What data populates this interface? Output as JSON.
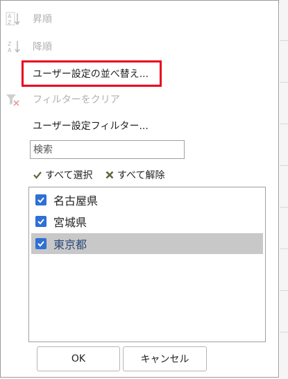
{
  "menu": {
    "sort_asc": "昇順",
    "sort_desc": "降順",
    "custom_sort": "ユーザー設定の並べ替え...",
    "clear_filter": "フィルターをクリア",
    "custom_filter": "ユーザー設定フィルター..."
  },
  "search": {
    "placeholder": "検索"
  },
  "selection": {
    "select_all": "すべて選択",
    "deselect_all": "すべて解除"
  },
  "items": [
    {
      "label": "名古屋県",
      "checked": true,
      "selected": false
    },
    {
      "label": "宮城県",
      "checked": true,
      "selected": false
    },
    {
      "label": "東京都",
      "checked": true,
      "selected": true
    }
  ],
  "buttons": {
    "ok": "OK",
    "cancel": "キャンセル"
  },
  "colors": {
    "highlight": "#e8001c",
    "checkbox": "#2f6fd6",
    "selected_row": "#c8c8c8"
  }
}
